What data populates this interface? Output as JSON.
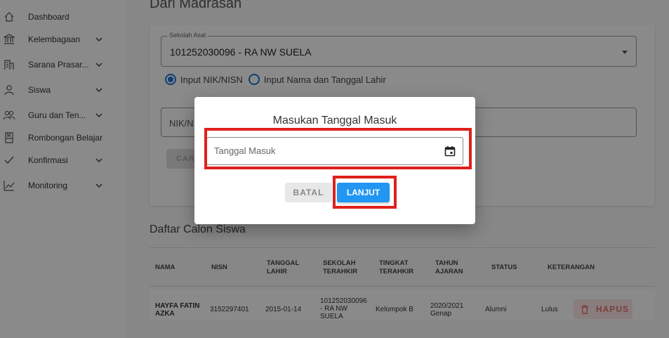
{
  "sidebar": {
    "items": [
      {
        "label": "Dashboard",
        "icon": "home-icon",
        "has_chevron": false
      },
      {
        "label": "Kelembagaan",
        "icon": "bank-icon",
        "has_chevron": true
      },
      {
        "label": "Sarana Prasar...",
        "icon": "building-icon",
        "has_chevron": true
      },
      {
        "label": "Siswa",
        "icon": "person-icon",
        "has_chevron": true
      },
      {
        "label": "Guru dan Ten...",
        "icon": "people-icon",
        "has_chevron": true
      },
      {
        "label": "Rombongan Belajar",
        "icon": "book-icon",
        "has_chevron": false
      },
      {
        "label": "Konfirmasi",
        "icon": "check-icon",
        "has_chevron": true
      },
      {
        "label": "Monitoring",
        "icon": "chart-icon",
        "has_chevron": true
      }
    ]
  },
  "main": {
    "title": "Dari Madrasah",
    "sekolah": {
      "legend": "Sekolah Asal",
      "value": "101252030096 - RA NW SUELA"
    },
    "radio": {
      "option1": "Input NIK/NISN",
      "option2": "Input Nama dan Tanggal Lahir"
    },
    "nik_placeholder": "NIK/N",
    "cari_label": "CAR",
    "section_title": "Daftar Calon Siswa",
    "table": {
      "headers": [
        "NAMA",
        "NISN",
        "TANGGAL LAHIR",
        "SEKOLAH TERAHKIR",
        "TINGKAT TERAHKIR",
        "TAHUN AJARAN",
        "STATUS",
        "KETERANGAN"
      ],
      "row": {
        "nama": "HAYFA FATIN AZKA",
        "nisn": "3152297401",
        "tanggal": "2015-01-14",
        "sekolah": "101252030096 - RA NW SUELA",
        "tingkat": "Kelompok B",
        "tahun": "2020/2021 Genap",
        "status": "Alumni",
        "keterangan": "Lulus"
      },
      "hapus_label": "HAPUS"
    }
  },
  "dialog": {
    "title": "Masukan Tanggal Masuk",
    "date_placeholder": "Tanggal Masuk",
    "batal_label": "BATAL",
    "lanjut_label": "LANJUT"
  },
  "colors": {
    "primary": "#2196f3",
    "highlight": "#e0201b",
    "danger": "#e57373"
  }
}
